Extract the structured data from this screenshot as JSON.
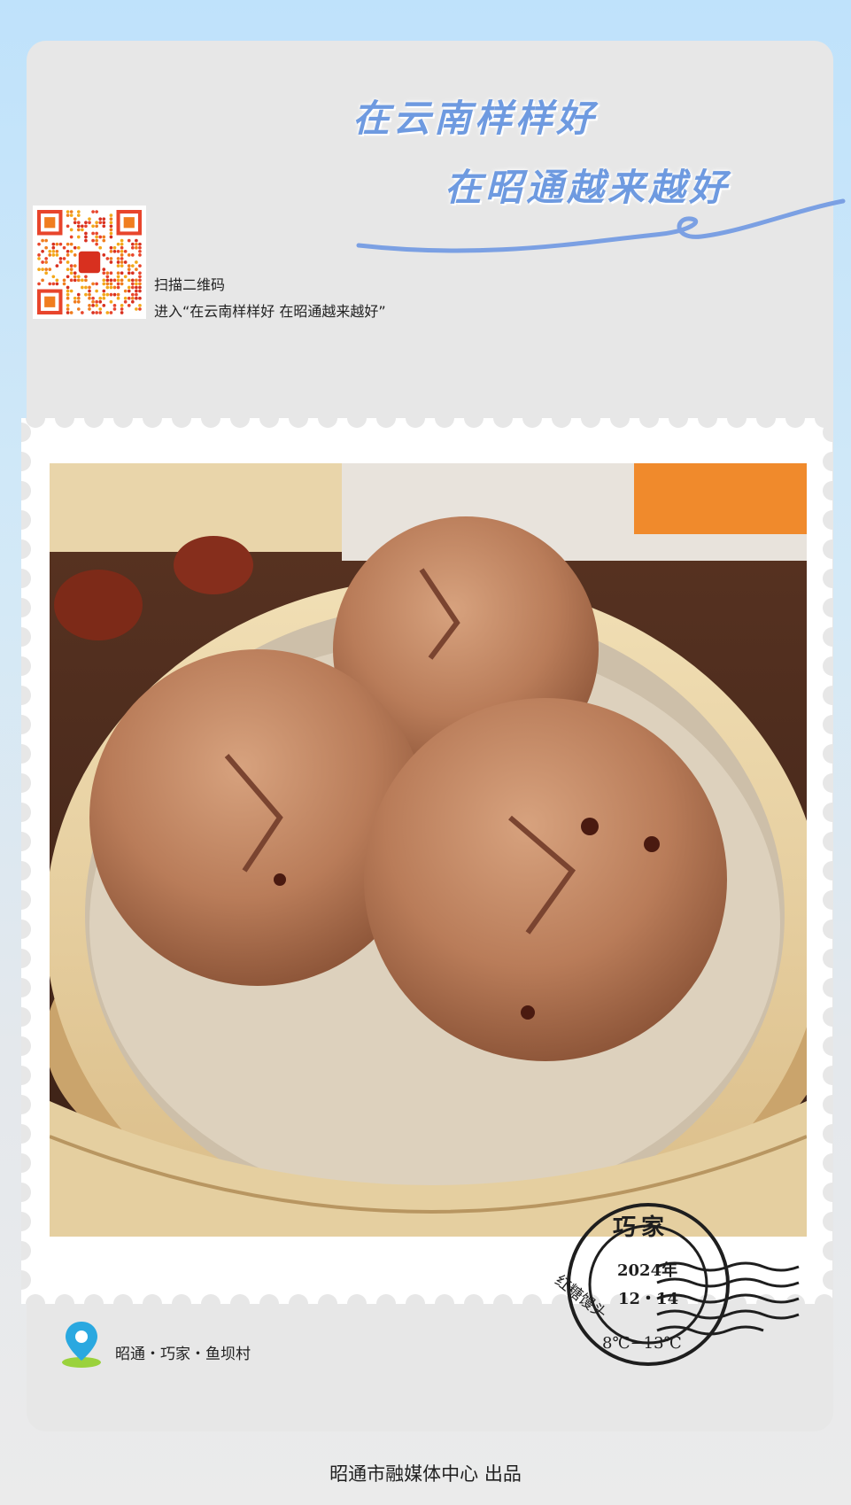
{
  "slogan": {
    "line1": "在云南样样好",
    "line2": "在昭通越来越好"
  },
  "qr": {
    "icon": "qr-code-icon",
    "caption_line1": "扫描二维码",
    "caption_line2": "进入“在云南样样好 在昭通越来越好”"
  },
  "photo": {
    "icon": "brown-sugar-steamed-buns-photo"
  },
  "location": {
    "icon": "map-pin-icon",
    "text": "昭通・巧家・鱼坝村"
  },
  "postmark": {
    "title": "巧家",
    "year": "2024年",
    "date": "12・14",
    "side": "红糖馒头",
    "temperature": "8℃−13℃"
  },
  "footer": {
    "text": "昭通市融媒体中心  出品"
  },
  "colors": {
    "slogan": "#6e9ae0",
    "accent_pin": "#2aa8e0",
    "card": "#e7e7e7"
  }
}
